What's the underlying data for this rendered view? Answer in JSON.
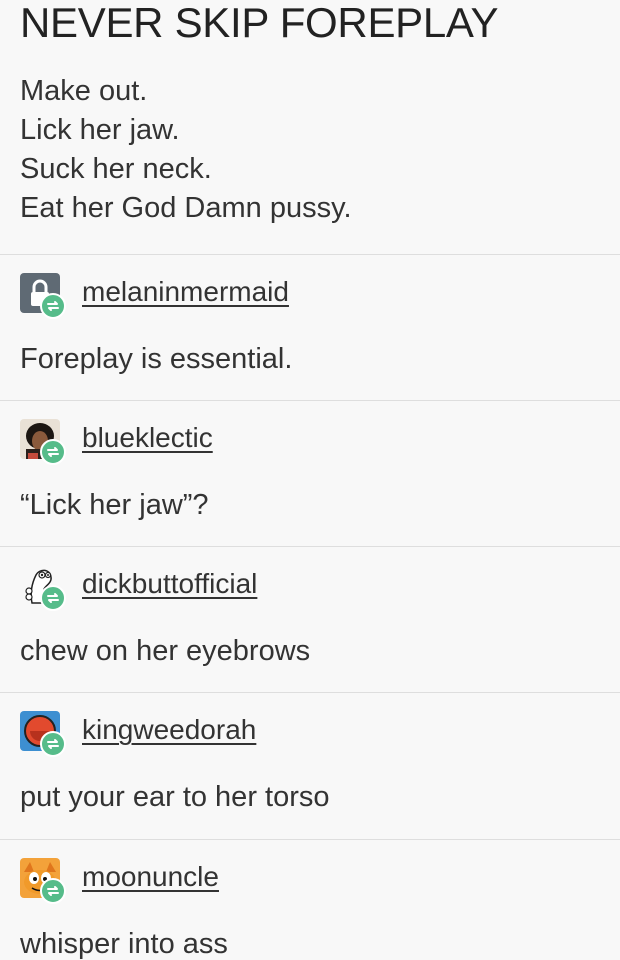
{
  "post": {
    "title": "NEVER SKIP FOREPLAY",
    "lines": [
      "Make out.",
      "Lick her jaw.",
      "Suck her neck.",
      "Eat her God Damn pussy."
    ]
  },
  "reblogs": [
    {
      "username": "melaninmermaid",
      "comment": "Foreplay is essential.",
      "avatar_icon": "lock-icon"
    },
    {
      "username": "blueklectic",
      "comment": "“Lick her jaw”?",
      "avatar_icon": "user-photo"
    },
    {
      "username": "dickbuttofficial",
      "comment": "chew on her eyebrows",
      "avatar_icon": "cartoon-drawing"
    },
    {
      "username": "kingweedorah",
      "comment": "put your ear to her torso",
      "avatar_icon": "red-circle-logo"
    },
    {
      "username": "moonuncle",
      "comment": "whisper into ass",
      "avatar_icon": "cartoon-cat"
    }
  ],
  "colors": {
    "reblog_badge": "#56bc8a",
    "background": "#f8f8f8",
    "divider": "#dedede",
    "text": "#333333"
  }
}
